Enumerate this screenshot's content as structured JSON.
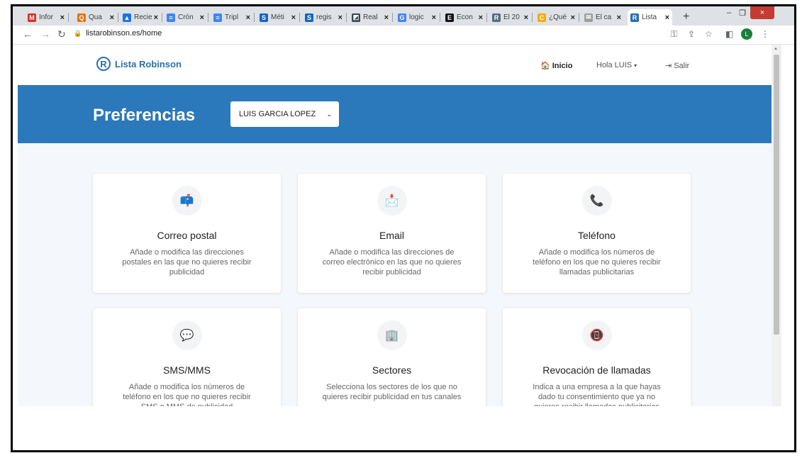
{
  "browser": {
    "tabs": [
      {
        "label": "Infor",
        "icon": "gmail-icon",
        "color": "#d93025",
        "glyph": "M"
      },
      {
        "label": "Qua",
        "icon": "quizizz-icon",
        "color": "#e8710a",
        "glyph": "Q"
      },
      {
        "label": "Recie",
        "icon": "drive-icon",
        "color": "#1a73e8",
        "glyph": "▲"
      },
      {
        "label": "Crón",
        "icon": "docs-icon",
        "color": "#4285f4",
        "glyph": "≡"
      },
      {
        "label": "Tripl",
        "icon": "docs-icon",
        "color": "#4285f4",
        "glyph": "≡"
      },
      {
        "label": "Méti",
        "icon": "s-icon",
        "color": "#1565c0",
        "glyph": "S"
      },
      {
        "label": "regis",
        "icon": "s-icon",
        "color": "#1565c0",
        "glyph": "S"
      },
      {
        "label": "Real",
        "icon": "image-icon",
        "color": "#37474f",
        "glyph": "◩"
      },
      {
        "label": "logic",
        "icon": "google-icon",
        "color": "#4285f4",
        "glyph": "G"
      },
      {
        "label": "Econ",
        "icon": "e-icon",
        "color": "#111111",
        "glyph": "E"
      },
      {
        "label": "El 20",
        "icon": "r-icon",
        "color": "#546e7a",
        "glyph": "R"
      },
      {
        "label": "¿Qué",
        "icon": "c-icon",
        "color": "#f9ab00",
        "glyph": "C"
      },
      {
        "label": "El ca",
        "icon": "mail-icon",
        "color": "#9e9e9e",
        "glyph": "✉"
      },
      {
        "label": "Lista",
        "icon": "robinson-icon",
        "color": "#2a6fb1",
        "glyph": "R",
        "active": true
      }
    ],
    "close_glyph": "×",
    "new_tab": "+",
    "minimize": "–",
    "restore": "❐",
    "close_window": "×",
    "url": "listarobinson.es/home",
    "avatar_letter": "L"
  },
  "site": {
    "logo_letter": "R",
    "logo_text": "Lista Robinson",
    "nav": {
      "home": "Inicio",
      "user": "Hola LUIS",
      "logout": "Salir"
    },
    "hero_title": "Preferencias",
    "selected_person": "LUIS GARCIA LOPEZ",
    "cards": [
      {
        "title": "Correo postal",
        "desc": "Añade o modifica las direcciones postales en las que no quieres recibir publicidad",
        "icon": "mailbox-icon",
        "glyph": "📫"
      },
      {
        "title": "Email",
        "desc": "Añade o modifica las direcciones de correo electrónico en las que no quieres recibir publicidad",
        "icon": "envelope-icon",
        "glyph": "📩"
      },
      {
        "title": "Teléfono",
        "desc": "Añade o modifica los números de teléfono en los que no quieres recibir llamadas publicitarias",
        "icon": "phone-icon",
        "glyph": "📞"
      },
      {
        "title": "SMS/MMS",
        "desc": "Añade o modifica los números de teléfono en los que no quieres recibir SMS o MMS de publicidad",
        "icon": "chat-bubble-icon",
        "glyph": "💬"
      },
      {
        "title": "Sectores",
        "desc": "Selecciona los sectores de los que no quieres recibir publicidad en tus canales",
        "icon": "building-icon",
        "glyph": "🏢"
      },
      {
        "title": "Revocación de llamadas",
        "desc": "Indica a una empresa a la que hayas dado tu consentimiento que ya no quieres recibir llamadas publicitarias",
        "icon": "phone-revoke-icon",
        "glyph": "📵"
      }
    ]
  }
}
